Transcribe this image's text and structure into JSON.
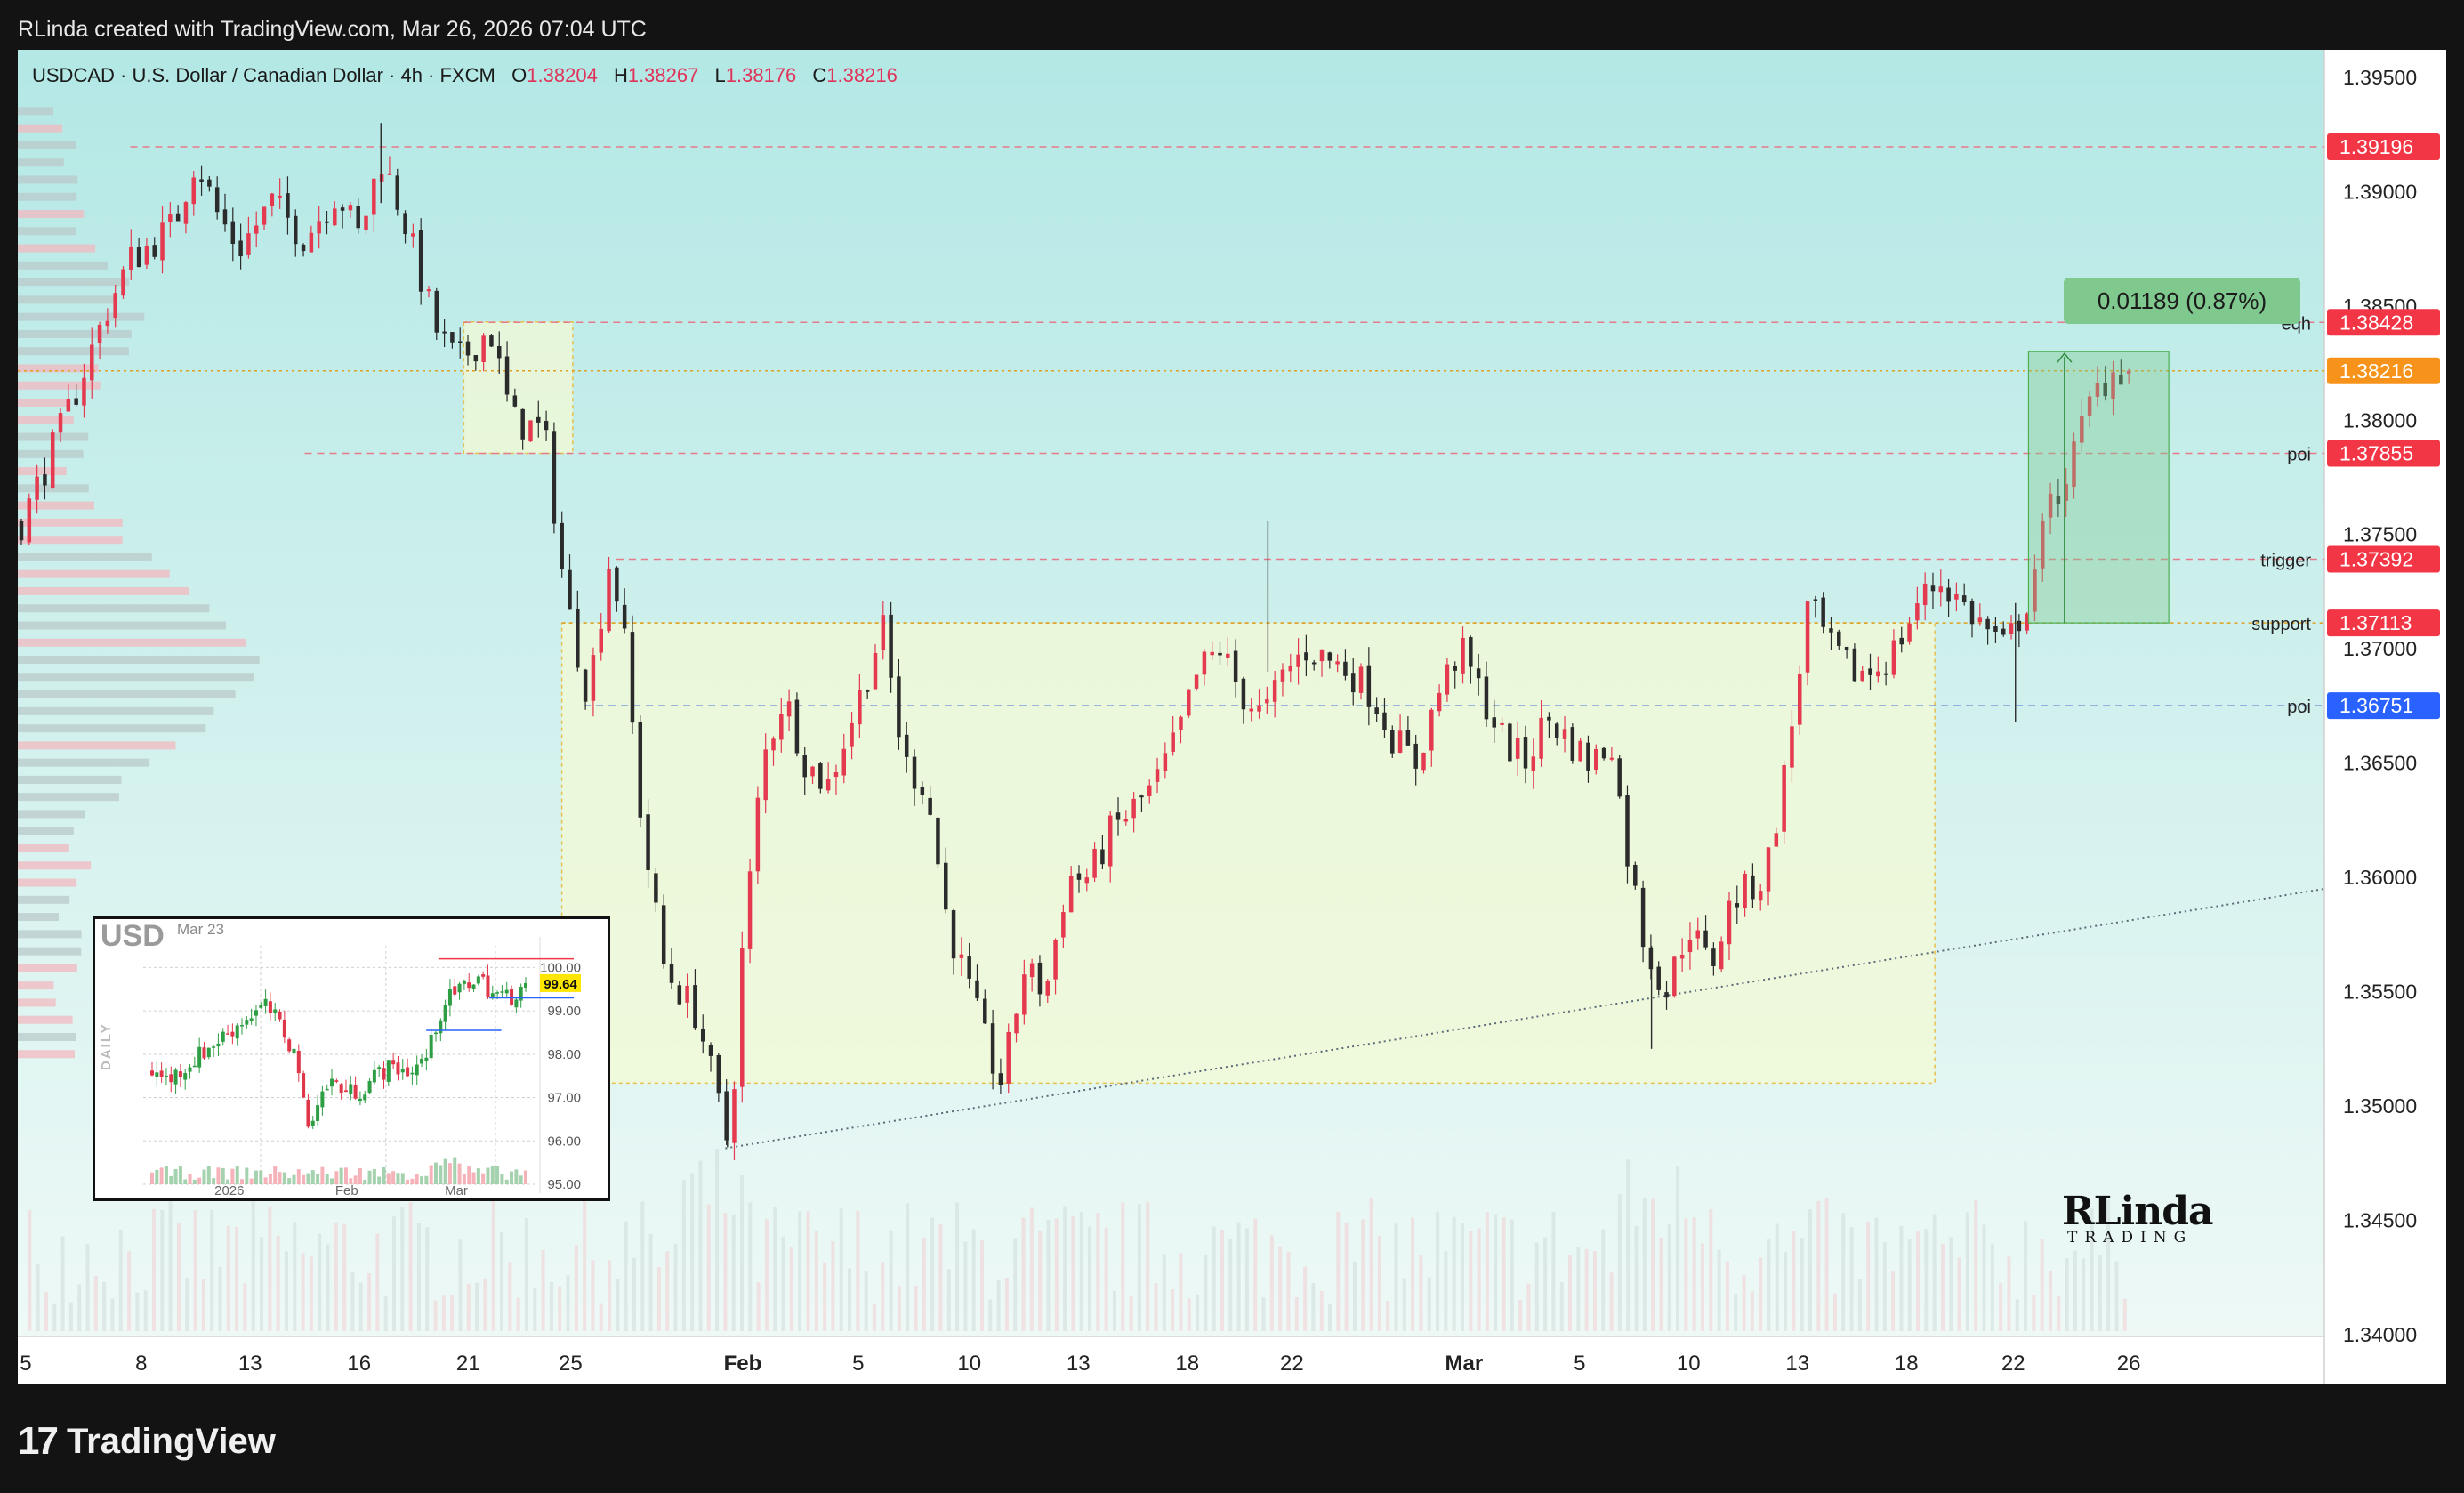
{
  "header": {
    "text": "RLinda created with TradingView.com, Mar 26, 2026 07:04 UTC"
  },
  "footer": {
    "brand": "TradingView",
    "mark": "17"
  },
  "legend": {
    "symbol": "USDCAD · U.S. Dollar / Canadian Dollar · 4h · FXCM",
    "o_label": "O",
    "o": "1.38204",
    "h_label": "H",
    "h": "1.38267",
    "l_label": "L",
    "l": "1.38176",
    "c_label": "C",
    "c": "1.38216"
  },
  "colors": {
    "up": "#e4394f",
    "down": "#2b2b2b",
    "bg_top": "#b3e8e5",
    "bg_bottom": "#eef9f6",
    "accent_green": "#7fc98f"
  },
  "measure": {
    "label": "0.01189 (0.87%)"
  },
  "watermark": {
    "name": "RLinda",
    "sub": "TRADING"
  },
  "chart_data": [
    {
      "type": "candlestick",
      "symbol": "USDCAD",
      "timeframe": "4h",
      "ylim": [
        1.34,
        1.3955
      ],
      "y_ticks": [
        "1.39500",
        "1.39000",
        "1.38500",
        "1.38000",
        "1.37500",
        "1.37000",
        "1.36500",
        "1.36000",
        "1.35500",
        "1.35000",
        "1.34500",
        "1.34000"
      ],
      "x_ticks": [
        "5",
        "8",
        "13",
        "16",
        "21",
        "25",
        "Feb",
        "5",
        "10",
        "13",
        "18",
        "22",
        "Mar",
        "5",
        "10",
        "13",
        "18",
        "22",
        "26"
      ],
      "x_tick_pos": [
        0.2,
        5.5,
        10.5,
        15.5,
        20.5,
        25.2,
        33.1,
        38.4,
        43.5,
        48.5,
        53.5,
        58.3,
        66.2,
        71.5,
        76.5,
        81.5,
        86.5,
        91.4,
        96.7
      ],
      "price_path": [
        [
          0,
          1.3755
        ],
        [
          2,
          1.38
        ],
        [
          4,
          1.385
        ],
        [
          5,
          1.387
        ],
        [
          7,
          1.3885
        ],
        [
          8,
          1.3915
        ],
        [
          9,
          1.389
        ],
        [
          10,
          1.3875
        ],
        [
          11.5,
          1.3895
        ],
        [
          13,
          1.388
        ],
        [
          14.5,
          1.39
        ],
        [
          15.5,
          1.388
        ],
        [
          16.5,
          1.3915
        ],
        [
          17.5,
          1.389
        ],
        [
          19,
          1.384
        ],
        [
          20,
          1.3825
        ],
        [
          21.5,
          1.384
        ],
        [
          22.5,
          1.38
        ],
        [
          24,
          1.3795
        ],
        [
          25,
          1.372
        ],
        [
          26,
          1.368
        ],
        [
          27,
          1.374
        ],
        [
          27.6,
          1.371
        ],
        [
          28.5,
          1.362
        ],
        [
          29.5,
          1.356
        ],
        [
          31,
          1.354
        ],
        [
          32,
          1.35
        ],
        [
          32.5,
          1.348
        ],
        [
          33,
          1.356
        ],
        [
          34,
          1.365
        ],
        [
          35,
          1.368
        ],
        [
          36,
          1.365
        ],
        [
          37,
          1.364
        ],
        [
          38.5,
          1.368
        ],
        [
          39.5,
          1.371
        ],
        [
          40.5,
          1.365
        ],
        [
          41.5,
          1.364
        ],
        [
          42.5,
          1.358
        ],
        [
          43.5,
          1.355
        ],
        [
          44.5,
          1.352
        ],
        [
          45,
          1.351
        ],
        [
          46,
          1.356
        ],
        [
          47,
          1.355
        ],
        [
          48,
          1.36
        ],
        [
          49,
          1.36
        ],
        [
          50,
          1.362
        ],
        [
          51,
          1.363
        ],
        [
          52,
          1.364
        ],
        [
          53,
          1.366
        ],
        [
          54,
          1.369
        ],
        [
          55,
          1.37
        ],
        [
          56,
          1.368
        ],
        [
          57,
          1.367
        ],
        [
          58,
          1.369
        ],
        [
          59,
          1.37
        ],
        [
          60,
          1.3695
        ],
        [
          61,
          1.369
        ],
        [
          62,
          1.368
        ],
        [
          63,
          1.366
        ],
        [
          64,
          1.365
        ],
        [
          65,
          1.368
        ],
        [
          66,
          1.37
        ],
        [
          67,
          1.368
        ],
        [
          68,
          1.366
        ],
        [
          69,
          1.365
        ],
        [
          70,
          1.367
        ],
        [
          71,
          1.366
        ],
        [
          72,
          1.365
        ],
        [
          73,
          1.366
        ],
        [
          73.5,
          1.362
        ],
        [
          74.5,
          1.357
        ],
        [
          75.5,
          1.355
        ],
        [
          76.5,
          1.358
        ],
        [
          77.5,
          1.356
        ],
        [
          78.5,
          1.359
        ],
        [
          80,
          1.36
        ],
        [
          81,
          1.365
        ],
        [
          82,
          1.372
        ],
        [
          83,
          1.37
        ],
        [
          84,
          1.369
        ],
        [
          85,
          1.369
        ],
        [
          86,
          1.37
        ],
        [
          87,
          1.372
        ],
        [
          88,
          1.373
        ],
        [
          89,
          1.372
        ],
        [
          90,
          1.371
        ],
        [
          91,
          1.37
        ],
        [
          92,
          1.372
        ],
        [
          93,
          1.376
        ],
        [
          94,
          1.378
        ],
        [
          95,
          1.381
        ],
        [
          96,
          1.3822
        ],
        [
          96.7,
          1.38216
        ]
      ],
      "candle_count": 270,
      "horizontal_levels": [
        {
          "price": 1.39196,
          "label": "",
          "tag": "1.39196",
          "color": "#f23645"
        },
        {
          "price": 1.38428,
          "label": "eqh",
          "tag": "1.38428",
          "color": "#f23645"
        },
        {
          "price": 1.38216,
          "label": "",
          "tag": "1.38216",
          "color": "#f7931a"
        },
        {
          "price": 1.37855,
          "label": "poi",
          "tag": "1.37855",
          "color": "#f23645"
        },
        {
          "price": 1.37392,
          "label": "trigger",
          "tag": "1.37392",
          "color": "#f23645"
        },
        {
          "price": 1.37113,
          "label": "support",
          "tag": "1.37113",
          "color": "#f23645"
        },
        {
          "price": 1.36751,
          "label": "poi",
          "tag": "1.36751",
          "color": "#2962ff"
        }
      ]
    },
    {
      "type": "candlestick",
      "title": "USD",
      "date_label": "Mar 23",
      "axis_side_label": "DAILY",
      "ylim": [
        95.0,
        100.5
      ],
      "y_ticks": [
        "100.00",
        "99.00",
        "98.00",
        "97.00",
        "96.00",
        "95.00"
      ],
      "current_value": "99.64",
      "x_ticks": [
        "2026",
        "Feb",
        "Mar"
      ],
      "price_path": [
        [
          0,
          97.6
        ],
        [
          4,
          97.4
        ],
        [
          8,
          97.7
        ],
        [
          12,
          98.0
        ],
        [
          16,
          98.3
        ],
        [
          20,
          98.6
        ],
        [
          24,
          98.9
        ],
        [
          28,
          99.1
        ],
        [
          32,
          98.6
        ],
        [
          36,
          97.8
        ],
        [
          38,
          96.2
        ],
        [
          40,
          96.8
        ],
        [
          44,
          97.4
        ],
        [
          48,
          97.1
        ],
        [
          52,
          97.2
        ],
        [
          56,
          97.6
        ],
        [
          60,
          97.7
        ],
        [
          64,
          97.6
        ],
        [
          68,
          98.0
        ],
        [
          70,
          98.7
        ],
        [
          72,
          99.2
        ],
        [
          76,
          99.5
        ],
        [
          80,
          99.8
        ],
        [
          84,
          99.4
        ],
        [
          88,
          99.3
        ],
        [
          92,
          99.64
        ]
      ]
    }
  ]
}
